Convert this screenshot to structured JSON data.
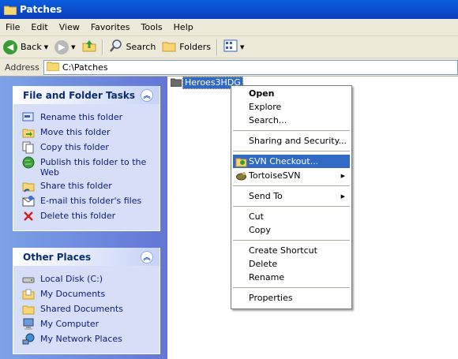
{
  "window": {
    "title": "Patches"
  },
  "menubar": [
    "File",
    "Edit",
    "View",
    "Favorites",
    "Tools",
    "Help"
  ],
  "toolbar": {
    "back_label": "Back",
    "search_label": "Search",
    "folders_label": "Folders"
  },
  "address": {
    "label": "Address",
    "value": "C:\\Patches"
  },
  "tasks_panel": {
    "title": "File and Folder Tasks",
    "items": [
      {
        "label": "Rename this folder",
        "icon": "rename-icon"
      },
      {
        "label": "Move this folder",
        "icon": "move-icon"
      },
      {
        "label": "Copy this folder",
        "icon": "copy-icon"
      },
      {
        "label": "Publish this folder to the Web",
        "icon": "publish-icon"
      },
      {
        "label": "Share this folder",
        "icon": "share-icon"
      },
      {
        "label": "E-mail this folder's files",
        "icon": "email-icon"
      },
      {
        "label": "Delete this folder",
        "icon": "delete-icon"
      }
    ]
  },
  "places_panel": {
    "title": "Other Places",
    "items": [
      {
        "label": "Local Disk (C:)",
        "icon": "disk-icon"
      },
      {
        "label": "My Documents",
        "icon": "folder-icon"
      },
      {
        "label": "Shared Documents",
        "icon": "folder-icon"
      },
      {
        "label": "My Computer",
        "icon": "computer-icon"
      },
      {
        "label": "My Network Places",
        "icon": "network-icon"
      }
    ]
  },
  "folder_item": {
    "label": "Heroes3HDG"
  },
  "context_menu": {
    "items": [
      {
        "label": "Open",
        "bold": true
      },
      {
        "label": "Explore"
      },
      {
        "label": "Search..."
      },
      {
        "label": "Sharing and Security..."
      },
      {
        "label": "SVN Checkout...",
        "highlighted": true,
        "icon": "svn-checkout-icon"
      },
      {
        "label": "TortoiseSVN",
        "submenu": true,
        "icon": "tortoisesvn-icon"
      },
      {
        "label": "Send To",
        "submenu": true
      },
      {
        "label": "Cut"
      },
      {
        "label": "Copy"
      },
      {
        "label": "Create Shortcut"
      },
      {
        "label": "Delete"
      },
      {
        "label": "Rename"
      },
      {
        "label": "Properties"
      }
    ]
  },
  "colors": {
    "title_bar": "#0a4bd0",
    "highlight": "#316ac5",
    "panel_link": "#0b1b7a"
  }
}
